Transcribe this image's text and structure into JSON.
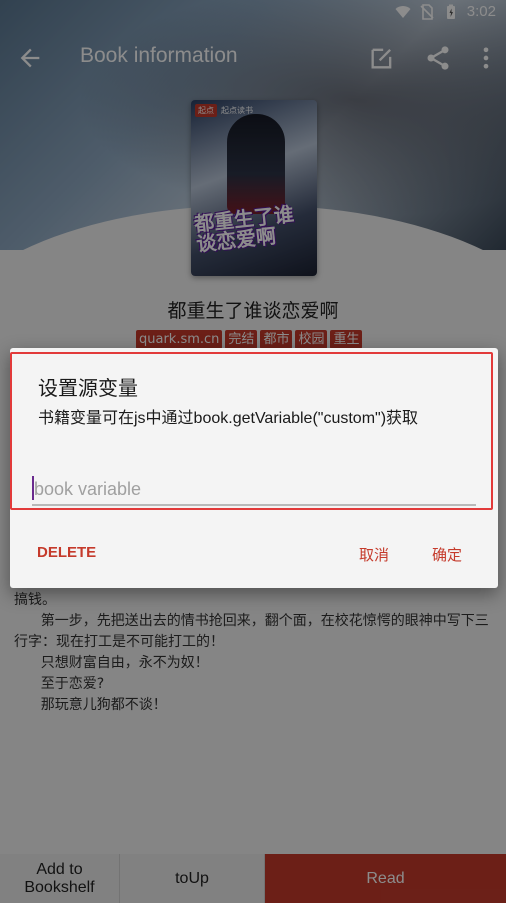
{
  "status_bar": {
    "time": "3:02"
  },
  "app_bar": {
    "title": "Book information"
  },
  "book": {
    "cover_brand": "起点",
    "cover_brand_text": "起点读书",
    "cover_title": "都重生了谁谈恋爱啊",
    "name": "都重生了谁谈恋爱啊",
    "tags": [
      "quark.sm.cn",
      "完结",
      "都市",
      "校园",
      "重生"
    ]
  },
  "intro": {
    "lines": [
      "搞钱。",
      "      第一步，先把送出去的情书抢回来，翻个面，在校花惊愕的眼神中写下三行字：现在打工是不可能打工的！",
      "      只想财富自由，永不为奴！",
      "      至于恋爱?",
      "      那玩意儿狗都不谈！"
    ]
  },
  "dialog": {
    "title": "设置源变量",
    "message": "书籍变量可在js中通过book.getVariable(\"custom\")获取",
    "input_placeholder": "book variable",
    "input_value": "",
    "delete_label": "DELETE",
    "cancel_label": "取消",
    "ok_label": "确定"
  },
  "bottom_bar": {
    "add_label": "Add to\nBookshelf",
    "toup_label": "toUp",
    "read_label": "Read"
  },
  "colors": {
    "accent": "#c53a2b",
    "highlight": "#e23a3a"
  },
  "icons": [
    "wifi-icon",
    "no-sim-icon",
    "battery-icon",
    "back-arrow-icon",
    "edit-icon",
    "share-icon",
    "more-vert-icon"
  ]
}
